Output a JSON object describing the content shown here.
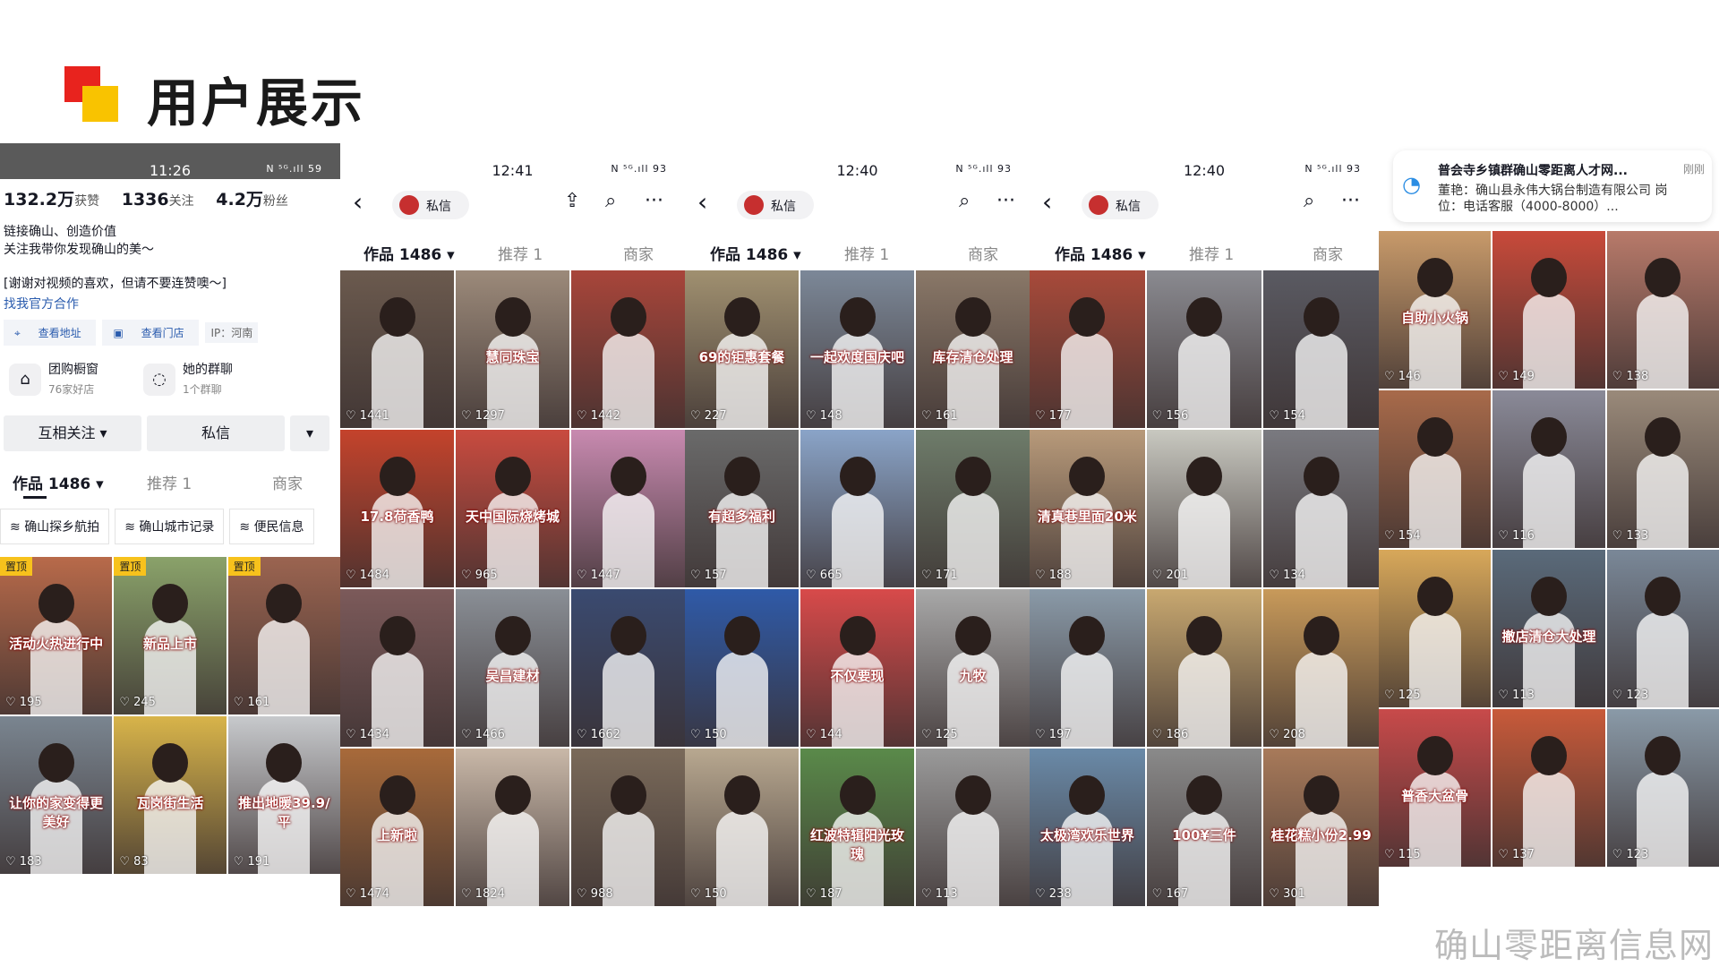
{
  "slide": {
    "title": "用户展示",
    "watermark": "确山零距离信息网"
  },
  "profile": {
    "status_time": "11:26",
    "status_icons": "N ⁵ᴳ.ıll 59",
    "likes_value": "132.2万",
    "likes_label": "获赞",
    "following_value": "1336",
    "following_label": "关注",
    "fans_value": "4.2万",
    "fans_label": "粉丝",
    "bio_line1": "链接确山、创造价值",
    "bio_line2": "关注我带你发现确山的美～",
    "bio_line3": "[谢谢对视频的喜欢，但请不要连赞噢～]",
    "link": "找我官方合作",
    "chip_address": "查看地址",
    "chip_store": "查看门店",
    "ip": "IP：河南",
    "svc1_title": "团购橱窗",
    "svc1_sub": "76家好店",
    "svc2_title": "她的群聊",
    "svc2_sub": "1个群聊",
    "btn_follow": "互相关注 ▾",
    "btn_message": "私信",
    "btn_more": "▾",
    "tab_works": "作品 1486 ▾",
    "tab_recommend": "推荐 1",
    "tab_merchant": "商家",
    "collection1": "确山探乡航拍",
    "collection2": "确山城市记录",
    "collection3": "便民信息",
    "pinned": "置顶",
    "videos": [
      {
        "caption": "活动火热进行中",
        "likes": "195",
        "color": "#b86a4a",
        "pinned": true
      },
      {
        "caption": "新品上市",
        "likes": "245",
        "color": "#8aa26a",
        "pinned": true
      },
      {
        "caption": "",
        "likes": "161",
        "color": "#9b6450",
        "pinned": true
      },
      {
        "caption": "让你的家变得更美好",
        "likes": "183",
        "color": "#7a8590",
        "pinned": false
      },
      {
        "caption": "瓦岗街生活",
        "likes": "83",
        "color": "#d8b44a",
        "pinned": false
      },
      {
        "caption": "推出地暖39.9/平",
        "likes": "191",
        "color": "#c7c9cc",
        "pinned": false
      }
    ]
  },
  "feed2": {
    "time": "12:41",
    "status": "N ⁵ᴳ.ıll 93",
    "pm": "私信",
    "tab_works": "作品 1486 ▾",
    "tab_recommend": "推荐 1",
    "tab_merchant": "商家",
    "videos": [
      {
        "caption": "",
        "likes": "1441",
        "color": "#6b5a4e"
      },
      {
        "caption": "慧同珠宝",
        "likes": "1297",
        "color": "#9c8a7a"
      },
      {
        "caption": "",
        "likes": "1442",
        "color": "#a8453a"
      },
      {
        "caption": "17.8荷香鸭",
        "likes": "1484",
        "color": "#c4432c"
      },
      {
        "caption": "天中国际烧烤城",
        "likes": "965",
        "color": "#c94b3f"
      },
      {
        "caption": "",
        "likes": "1447",
        "color": "#c88ab0"
      },
      {
        "caption": "",
        "likes": "1434",
        "color": "#7c5a5a"
      },
      {
        "caption": "吴昌建材",
        "likes": "1466",
        "color": "#8a8f96"
      },
      {
        "caption": "",
        "likes": "1662",
        "color": "#3a4a70"
      },
      {
        "caption": "上新啦",
        "likes": "1474",
        "color": "#a86a3a"
      },
      {
        "caption": "",
        "likes": "1824",
        "color": "#c9b8a8"
      },
      {
        "caption": "",
        "likes": "988",
        "color": "#7a6a5a"
      }
    ]
  },
  "feed3": {
    "time": "12:40",
    "status": "N ⁵ᴳ.ıll 93",
    "pm": "私信",
    "tab_works": "作品 1486 ▾",
    "tab_recommend": "推荐 1",
    "tab_merchant": "商家",
    "videos": [
      {
        "caption": "69的钜惠套餐",
        "likes": "227",
        "color": "#a09070"
      },
      {
        "caption": "一起欢度国庆吧",
        "likes": "148",
        "color": "#7c8898"
      },
      {
        "caption": "库存清仓处理",
        "likes": "161",
        "color": "#8a7868"
      },
      {
        "caption": "有超多福利",
        "likes": "157",
        "color": "#6a6a6a"
      },
      {
        "caption": "",
        "likes": "665",
        "color": "#8aa4c8"
      },
      {
        "caption": "",
        "likes": "171",
        "color": "#6e7c6a"
      },
      {
        "caption": "",
        "likes": "150",
        "color": "#2f5aa8"
      },
      {
        "caption": "不仅要现",
        "likes": "144",
        "color": "#d84a4a"
      },
      {
        "caption": "九牧",
        "likes": "125",
        "color": "#a8a8a8"
      },
      {
        "caption": "",
        "likes": "150",
        "color": "#b8a890"
      },
      {
        "caption": "红波特辑阳光玫瑰",
        "likes": "187",
        "color": "#5a8a4a"
      },
      {
        "caption": "",
        "likes": "113",
        "color": "#9a9a9a"
      }
    ]
  },
  "feed4": {
    "time": "12:40",
    "status": "N ⁵ᴳ.ıll 93",
    "pm": "私信",
    "tab_works": "作品 1486 ▾",
    "tab_recommend": "推荐 1",
    "tab_merchant": "商家",
    "videos": [
      {
        "caption": "",
        "likes": "177",
        "color": "#a84a3a"
      },
      {
        "caption": "",
        "likes": "156",
        "color": "#8a8a90"
      },
      {
        "caption": "",
        "likes": "154",
        "color": "#5a5a62"
      },
      {
        "caption": "清真巷里面20米",
        "likes": "188",
        "color": "#b89a7a"
      },
      {
        "caption": "",
        "likes": "201",
        "color": "#c8c8c0"
      },
      {
        "caption": "",
        "likes": "134",
        "color": "#7a7a80"
      },
      {
        "caption": "",
        "likes": "197",
        "color": "#8a9aa8"
      },
      {
        "caption": "",
        "likes": "186",
        "color": "#c8a870"
      },
      {
        "caption": "",
        "likes": "208",
        "color": "#c89a5a"
      },
      {
        "caption": "太极湾欢乐世界",
        "likes": "238",
        "color": "#6a8aa8"
      },
      {
        "caption": "100¥三件",
        "likes": "167",
        "color": "#8a8a8a"
      },
      {
        "caption": "桂花糕小份2.99",
        "likes": "301",
        "color": "#a87a5a"
      }
    ]
  },
  "feed5": {
    "notice_title": "普会寺乡镇群确山零距离人才网...",
    "notice_body": "董艳：确山县永伟大锅台制造有限公司 岗位：电话客服（4000-8000）...",
    "notice_time": "刚刚",
    "videos": [
      {
        "caption": "自助小火锅",
        "likes": "146",
        "color": "#c89a6a"
      },
      {
        "caption": "",
        "likes": "149",
        "color": "#c84a3a"
      },
      {
        "caption": "",
        "likes": "138",
        "color": "#b87a6a"
      },
      {
        "caption": "",
        "likes": "154",
        "color": "#a86a4a"
      },
      {
        "caption": "",
        "likes": "116",
        "color": "#8a8a98"
      },
      {
        "caption": "",
        "likes": "133",
        "color": "#9a8a7a"
      },
      {
        "caption": "",
        "likes": "125",
        "color": "#d8a85a"
      },
      {
        "caption": "撤店清仓大处理",
        "likes": "113",
        "color": "#5a6a7a"
      },
      {
        "caption": "",
        "likes": "123",
        "color": "#7a8898"
      },
      {
        "caption": "普香大盆骨",
        "likes": "115",
        "color": "#c84a4a"
      },
      {
        "caption": "",
        "likes": "137",
        "color": "#c85a3a"
      },
      {
        "caption": "",
        "likes": "123",
        "color": "#8a9aa8"
      }
    ]
  }
}
